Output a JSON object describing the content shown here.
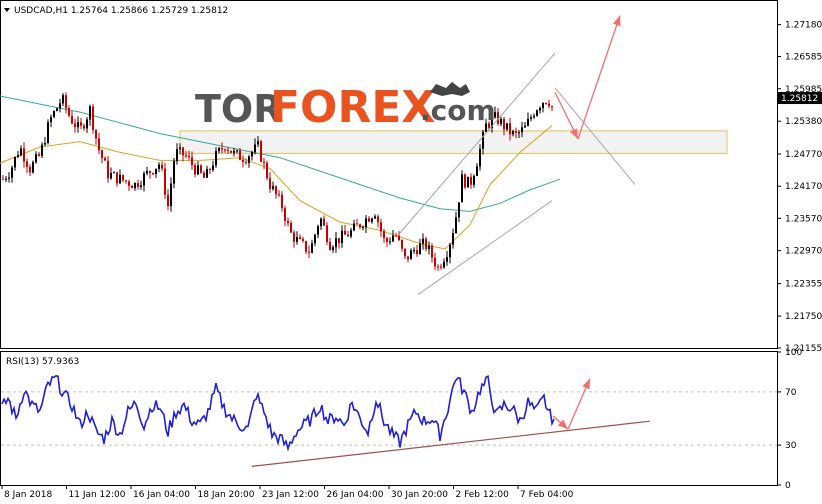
{
  "header": {
    "symbol_info": "USDCAD,H1  1.25764 1.25866 1.25729 1.25812",
    "rsi_info": "RSI(13) 57.9363"
  },
  "watermark": {
    "brand_tor": "TOR",
    "brand_forex": "FOREX",
    "brand_com": ".com",
    "colors": {
      "tor": "#555555",
      "forex": "#e8531f"
    }
  },
  "colors": {
    "up": "#000000",
    "down": "#cc0000",
    "ma_slow": "#3aa89a",
    "ma_fast": "#d4a520",
    "rsi": "#1f1fd6",
    "channel": "#a7a7a7",
    "forecast": "#f07070",
    "zone_fill": "#f2f2f2",
    "zone_border": "#e5c25c",
    "support_line": "#a0504a",
    "current_price_box": "#000000"
  },
  "chart_data": [
    {
      "type": "candlestick",
      "title": "",
      "ylabel": "",
      "ylim": [
        1.21155,
        1.2762
      ],
      "y_ticks": [
        "1.27180",
        "1.26585",
        "1.25985",
        "1.25380",
        "1.24770",
        "1.24170",
        "1.23570",
        "1.22970",
        "1.22355",
        "1.21750",
        "1.21155"
      ],
      "x_ticks": [
        "8 Jan 2018",
        "11 Jan 12:00",
        "16 Jan 04:00",
        "18 Jan 20:00",
        "23 Jan 12:00",
        "26 Jan 04:00",
        "30 Jan 20:00",
        "2 Feb 12:00",
        "7 Feb 04:00"
      ],
      "current_price": "1.25812",
      "price_path": [
        [
          0,
          1.2425
        ],
        [
          10,
          1.2445
        ],
        [
          20,
          1.249
        ],
        [
          30,
          1.245
        ],
        [
          40,
          1.2475
        ],
        [
          50,
          1.254
        ],
        [
          62,
          1.258
        ],
        [
          70,
          1.2545
        ],
        [
          80,
          1.252
        ],
        [
          90,
          1.256
        ],
        [
          98,
          1.249
        ],
        [
          108,
          1.244
        ],
        [
          120,
          1.243
        ],
        [
          135,
          1.242
        ],
        [
          150,
          1.2445
        ],
        [
          160,
          1.246
        ],
        [
          168,
          1.238
        ],
        [
          175,
          1.248
        ],
        [
          185,
          1.2475
        ],
        [
          195,
          1.245
        ],
        [
          205,
          1.243
        ],
        [
          215,
          1.247
        ],
        [
          225,
          1.2495
        ],
        [
          235,
          1.2475
        ],
        [
          245,
          1.247
        ],
        [
          258,
          1.249
        ],
        [
          270,
          1.242
        ],
        [
          282,
          1.238
        ],
        [
          290,
          1.233
        ],
        [
          300,
          1.231
        ],
        [
          310,
          1.2295
        ],
        [
          320,
          1.236
        ],
        [
          330,
          1.231
        ],
        [
          340,
          1.232
        ],
        [
          350,
          1.233
        ],
        [
          362,
          1.235
        ],
        [
          375,
          1.237
        ],
        [
          385,
          1.231
        ],
        [
          395,
          1.233
        ],
        [
          405,
          1.228
        ],
        [
          415,
          1.23
        ],
        [
          425,
          1.231
        ],
        [
          438,
          1.2265
        ],
        [
          448,
          1.23
        ],
        [
          455,
          1.235
        ],
        [
          462,
          1.243
        ],
        [
          470,
          1.242
        ],
        [
          478,
          1.247
        ],
        [
          486,
          1.253
        ],
        [
          496,
          1.2545
        ],
        [
          506,
          1.2525
        ],
        [
          515,
          1.251
        ],
        [
          525,
          1.2525
        ],
        [
          535,
          1.256
        ],
        [
          542,
          1.2575
        ],
        [
          548,
          1.258
        ],
        [
          553,
          1.256
        ]
      ],
      "series": [
        {
          "type": "line",
          "points": [
            [
              0,
              1.2585
            ],
            [
              40,
              1.257
            ],
            [
              80,
              1.2555
            ],
            [
              120,
              1.2535
            ],
            [
              160,
              1.2515
            ],
            [
              200,
              1.25
            ],
            [
              240,
              1.2485
            ],
            [
              280,
              1.247
            ],
            [
              320,
              1.2445
            ],
            [
              360,
              1.242
            ],
            [
              400,
              1.2395
            ],
            [
              440,
              1.2375
            ],
            [
              470,
              1.237
            ],
            [
              500,
              1.2385
            ],
            [
              530,
              1.241
            ],
            [
              560,
              1.243
            ]
          ]
        },
        {
          "type": "line",
          "points": [
            [
              0,
              1.246
            ],
            [
              40,
              1.249
            ],
            [
              80,
              1.25
            ],
            [
              120,
              1.248
            ],
            [
              160,
              1.2465
            ],
            [
              200,
              1.2465
            ],
            [
              240,
              1.247
            ],
            [
              270,
              1.245
            ],
            [
              300,
              1.239
            ],
            [
              340,
              1.235
            ],
            [
              380,
              1.2335
            ],
            [
              420,
              1.231
            ],
            [
              445,
              1.23
            ],
            [
              470,
              1.2345
            ],
            [
              490,
              1.242
            ],
            [
              520,
              1.248
            ],
            [
              552,
              1.253
            ]
          ]
        }
      ],
      "channel_lines": [
        [
          [
            418,
            1.2215
          ],
          [
            552,
            1.239
          ]
        ],
        [
          [
            400,
            1.233
          ],
          [
            555,
            1.2665
          ]
        ],
        [
          [
            555,
            1.26
          ],
          [
            635,
            1.242
          ]
        ]
      ],
      "forecast_path": [
        [
          555,
          1.2592
        ],
        [
          578,
          1.2505
        ],
        [
          620,
          1.2735
        ]
      ],
      "zone": {
        "x0": 180,
        "x1": 727,
        "y_top": 1.252,
        "y_bottom": 1.2478
      }
    },
    {
      "type": "line",
      "title": "",
      "ylim": [
        0,
        100
      ],
      "y_ticks": [
        "100",
        "70",
        "30",
        "0"
      ],
      "rsi_path": [
        [
          0,
          55
        ],
        [
          8,
          65
        ],
        [
          16,
          50
        ],
        [
          24,
          72
        ],
        [
          32,
          60
        ],
        [
          40,
          55
        ],
        [
          48,
          75
        ],
        [
          56,
          80
        ],
        [
          64,
          68
        ],
        [
          72,
          60
        ],
        [
          80,
          45
        ],
        [
          88,
          55
        ],
        [
          96,
          40
        ],
        [
          104,
          35
        ],
        [
          112,
          48
        ],
        [
          120,
          38
        ],
        [
          128,
          55
        ],
        [
          136,
          62
        ],
        [
          144,
          45
        ],
        [
          152,
          60
        ],
        [
          160,
          58
        ],
        [
          168,
          40
        ],
        [
          176,
          55
        ],
        [
          184,
          60
        ],
        [
          192,
          48
        ],
        [
          200,
          45
        ],
        [
          208,
          55
        ],
        [
          216,
          72
        ],
        [
          224,
          58
        ],
        [
          232,
          50
        ],
        [
          240,
          45
        ],
        [
          248,
          42
        ],
        [
          256,
          68
        ],
        [
          264,
          55
        ],
        [
          272,
          38
        ],
        [
          280,
          35
        ],
        [
          288,
          28
        ],
        [
          296,
          40
        ],
        [
          304,
          45
        ],
        [
          312,
          50
        ],
        [
          320,
          60
        ],
        [
          328,
          48
        ],
        [
          336,
          52
        ],
        [
          344,
          45
        ],
        [
          352,
          62
        ],
        [
          360,
          50
        ],
        [
          368,
          40
        ],
        [
          376,
          65
        ],
        [
          384,
          48
        ],
        [
          392,
          38
        ],
        [
          400,
          32
        ],
        [
          408,
          45
        ],
        [
          416,
          55
        ],
        [
          424,
          48
        ],
        [
          432,
          50
        ],
        [
          440,
          38
        ],
        [
          448,
          58
        ],
        [
          456,
          82
        ],
        [
          464,
          70
        ],
        [
          472,
          55
        ],
        [
          480,
          72
        ],
        [
          488,
          78
        ],
        [
          496,
          52
        ],
        [
          504,
          60
        ],
        [
          512,
          58
        ],
        [
          520,
          48
        ],
        [
          528,
          62
        ],
        [
          536,
          55
        ],
        [
          544,
          65
        ],
        [
          550,
          52
        ],
        [
          554,
          50
        ]
      ],
      "support_line": [
        [
          252,
          14
        ],
        [
          650,
          48
        ]
      ],
      "forecast_path": [
        [
          553,
          52
        ],
        [
          568,
          42
        ],
        [
          590,
          80
        ]
      ]
    }
  ]
}
